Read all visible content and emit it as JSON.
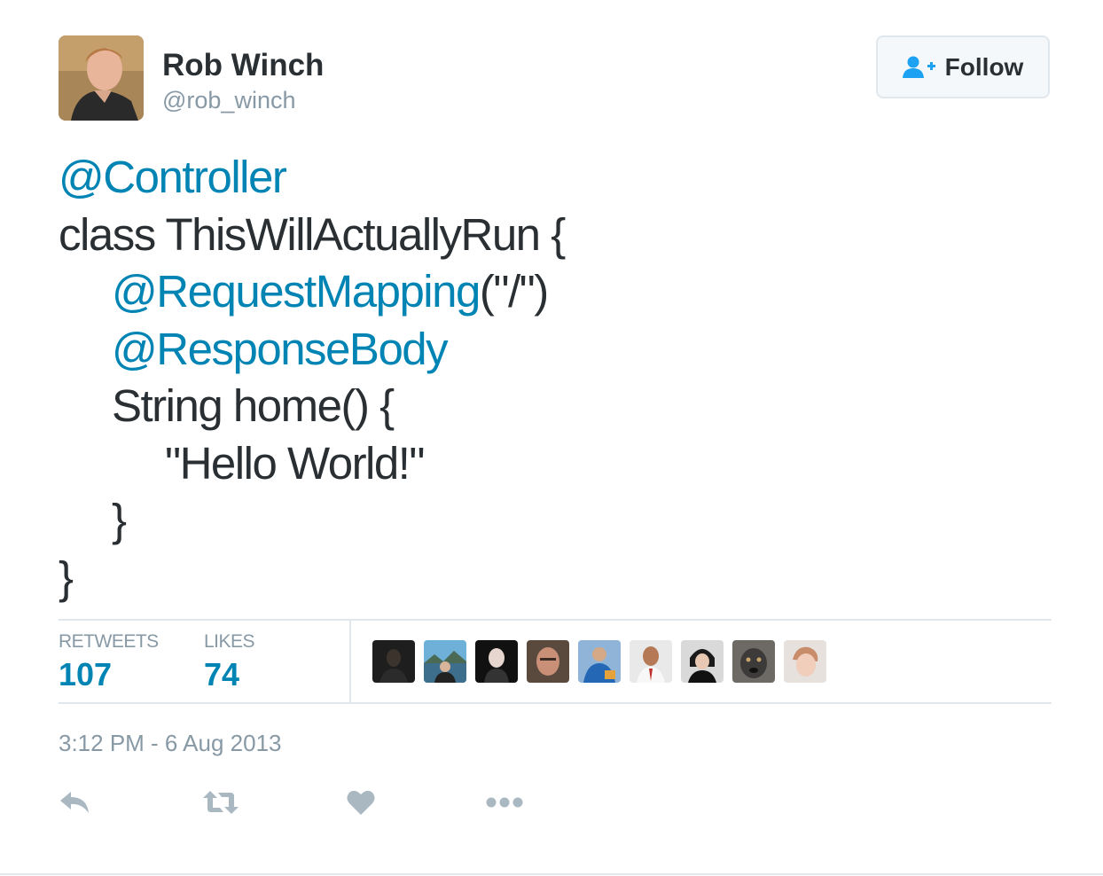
{
  "author": {
    "name": "Rob Winch",
    "handle": "@rob_winch",
    "avatar_icon": "profile-photo"
  },
  "follow_button": {
    "label": "Follow",
    "icon": "add-user-icon",
    "icon_color": "#1da1f2"
  },
  "tweet_text": {
    "lines": [
      {
        "parts": [
          {
            "text": "@Controller",
            "type": "mention"
          }
        ]
      },
      {
        "parts": [
          {
            "text": "class ThisWillActuallyRun {",
            "type": "text"
          }
        ]
      },
      {
        "parts": [
          {
            "text": "@RequestMapping",
            "type": "mention"
          },
          {
            "text": "(\"/\")",
            "type": "text"
          }
        ]
      },
      {
        "parts": [
          {
            "text": "@ResponseBody",
            "type": "mention"
          }
        ]
      },
      {
        "parts": [
          {
            "text": "String home() {",
            "type": "text"
          }
        ]
      },
      {
        "parts": [
          {
            "text": "\"Hello World!\"",
            "type": "text"
          }
        ]
      },
      {
        "parts": [
          {
            "text": "}",
            "type": "text"
          }
        ]
      },
      {
        "parts": [
          {
            "text": "}",
            "type": "text"
          }
        ]
      }
    ]
  },
  "stats": {
    "retweets_label": "RETWEETS",
    "retweets_count": "107",
    "likes_label": "LIKES",
    "likes_count": "74"
  },
  "likers": [
    {
      "name": "liker-avatar-1"
    },
    {
      "name": "liker-avatar-2"
    },
    {
      "name": "liker-avatar-3"
    },
    {
      "name": "liker-avatar-4"
    },
    {
      "name": "liker-avatar-5"
    },
    {
      "name": "liker-avatar-6"
    },
    {
      "name": "liker-avatar-7"
    },
    {
      "name": "liker-avatar-8"
    },
    {
      "name": "liker-avatar-9"
    }
  ],
  "timestamp": "3:12 PM - 6 Aug 2013",
  "actions": {
    "reply_icon": "reply-icon",
    "retweet_icon": "retweet-icon",
    "like_icon": "heart-icon",
    "more_icon": "more-icon",
    "icon_color": "#aab8c2"
  },
  "colors": {
    "mention": "#0084b4",
    "text": "#292f33",
    "muted": "#8899a6",
    "border": "#e1e8ed"
  }
}
